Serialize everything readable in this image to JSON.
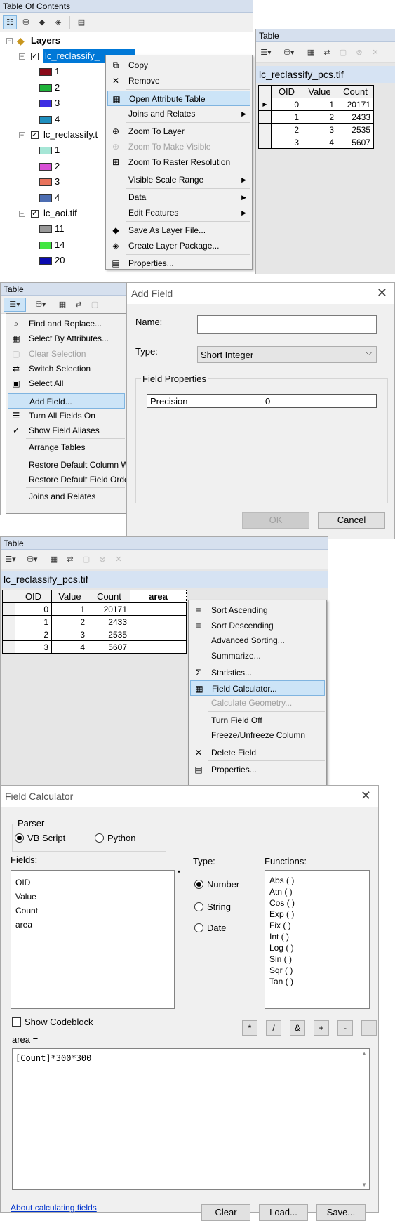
{
  "toc": {
    "title": "Table Of Contents",
    "root_label": "Layers",
    "layers": [
      {
        "name": "lc_reclassify_",
        "classes": [
          {
            "label": "1",
            "color": "#8b0a1a"
          },
          {
            "label": "2",
            "color": "#1fb33a"
          },
          {
            "label": "3",
            "color": "#3d2ee3"
          },
          {
            "label": "4",
            "color": "#1f8fbf"
          }
        ]
      },
      {
        "name": "lc_reclassify.t",
        "classes": [
          {
            "label": "1",
            "color": "#a6e6d6"
          },
          {
            "label": "2",
            "color": "#d84fd6"
          },
          {
            "label": "3",
            "color": "#e8735c"
          },
          {
            "label": "4",
            "color": "#4c6db2"
          }
        ]
      },
      {
        "name": "lc_aoi.tif",
        "classes": [
          {
            "label": "11",
            "color": "#999999"
          },
          {
            "label": "14",
            "color": "#42e642"
          },
          {
            "label": "20",
            "color": "#0b0bb0"
          }
        ]
      }
    ]
  },
  "layer_menu": {
    "items": [
      {
        "label": "Copy",
        "icon": "copy-icon",
        "glyph": "⧉"
      },
      {
        "label": "Remove",
        "icon": "remove-icon",
        "glyph": "✕"
      },
      {
        "label": "Open Attribute Table",
        "icon": "table-icon",
        "glyph": "▦",
        "highlight": true
      },
      {
        "label": "Joins and Relates",
        "submenu": true
      },
      {
        "label": "Zoom To Layer",
        "icon": "zoom-layer-icon",
        "glyph": "⊕"
      },
      {
        "label": "Zoom To Make Visible",
        "icon": "zoom-visible-icon",
        "glyph": "⊕",
        "disabled": true
      },
      {
        "label": "Zoom To Raster Resolution",
        "icon": "zoom-raster-icon",
        "glyph": "⊞"
      },
      {
        "label": "Visible Scale Range",
        "submenu": true
      },
      {
        "label": "Data",
        "submenu": true
      },
      {
        "label": "Edit Features",
        "submenu": true
      },
      {
        "label": "Save As Layer File...",
        "icon": "layer-file-icon",
        "glyph": "◆"
      },
      {
        "label": "Create Layer Package...",
        "icon": "package-icon",
        "glyph": "◈"
      },
      {
        "label": "Properties...",
        "icon": "properties-icon",
        "glyph": "▤"
      }
    ]
  },
  "table1": {
    "title": "Table",
    "tab_name": "lc_reclassify_pcs.tif",
    "columns": [
      "OID",
      "Value",
      "Count"
    ],
    "rows": [
      [
        "0",
        "1",
        "20171"
      ],
      [
        "1",
        "2",
        "2433"
      ],
      [
        "2",
        "3",
        "2535"
      ],
      [
        "3",
        "4",
        "5607"
      ]
    ]
  },
  "table2": {
    "title": "Table",
    "menu": {
      "items": [
        {
          "label": "Find and Replace...",
          "icon": "binoculars-icon",
          "glyph": "⌕"
        },
        {
          "label": "Select By Attributes...",
          "icon": "select-attributes-icon",
          "glyph": "▦"
        },
        {
          "label": "Clear Selection",
          "icon": "clear-selection-icon",
          "glyph": "▢",
          "disabled": true
        },
        {
          "label": "Switch Selection",
          "icon": "switch-selection-icon",
          "glyph": "⇄"
        },
        {
          "label": "Select All",
          "icon": "select-all-icon",
          "glyph": "▣"
        },
        {
          "label": "Add Field...",
          "highlight": true
        },
        {
          "label": "Turn All Fields On",
          "icon": "fields-on-icon",
          "glyph": "☰"
        },
        {
          "label": "Show Field Aliases",
          "icon": "check-icon",
          "glyph": "✓"
        },
        {
          "label": "Arrange Tables"
        },
        {
          "label": "Restore Default Column W"
        },
        {
          "label": "Restore Default Field Orde"
        },
        {
          "label": "Joins and Relates"
        }
      ]
    }
  },
  "add_field": {
    "title": "Add Field",
    "name_label": "Name:",
    "name_value": "",
    "type_label": "Type:",
    "type_value": "Short Integer",
    "props_label": "Field Properties",
    "prop_name": "Precision",
    "prop_value": "0",
    "ok": "OK",
    "cancel": "Cancel"
  },
  "table3": {
    "title": "Table",
    "tab_name": "lc_reclassify_pcs.tif",
    "columns": [
      "OID",
      "Value",
      "Count",
      "area"
    ],
    "rows": [
      [
        "0",
        "1",
        "20171",
        ""
      ],
      [
        "1",
        "2",
        "2433",
        ""
      ],
      [
        "2",
        "3",
        "2535",
        ""
      ],
      [
        "3",
        "4",
        "5607",
        ""
      ]
    ],
    "menu": {
      "items": [
        {
          "label": "Sort Ascending",
          "icon": "sort-ascending-icon",
          "glyph": "≡"
        },
        {
          "label": "Sort Descending",
          "icon": "sort-descending-icon",
          "glyph": "≡"
        },
        {
          "label": "Advanced Sorting..."
        },
        {
          "label": "Summarize..."
        },
        {
          "label": "Statistics...",
          "icon": "sigma-icon",
          "glyph": "Σ"
        },
        {
          "label": "Field Calculator...",
          "icon": "calculator-icon",
          "glyph": "▦",
          "highlight": true
        },
        {
          "label": "Calculate Geometry...",
          "disabled": true
        },
        {
          "label": "Turn Field Off"
        },
        {
          "label": "Freeze/Unfreeze Column"
        },
        {
          "label": "Delete Field",
          "icon": "delete-icon",
          "glyph": "✕"
        },
        {
          "label": "Properties...",
          "icon": "properties-icon",
          "glyph": "▤"
        }
      ]
    }
  },
  "field_calc": {
    "title": "Field Calculator",
    "parser_label": "Parser",
    "parser_vb": "VB Script",
    "parser_py": "Python",
    "fields_label": "Fields:",
    "fields": [
      "OID",
      "Value",
      "Count",
      "area"
    ],
    "type_label": "Type:",
    "type_number": "Number",
    "type_string": "String",
    "type_date": "Date",
    "functions_label": "Functions:",
    "functions": [
      "Abs ( )",
      "Atn ( )",
      "Cos ( )",
      "Exp ( )",
      "Fix ( )",
      "Int ( )",
      "Log ( )",
      "Sin ( )",
      "Sqr ( )",
      "Tan ( )"
    ],
    "show_codeblock": "Show Codeblock",
    "operators": [
      "*",
      "/",
      "&",
      "+",
      "-",
      "="
    ],
    "expr_label": "area =",
    "expression": "[Count]*300*300",
    "help_link": "About calculating fields",
    "clear": "Clear",
    "load": "Load...",
    "save": "Save..."
  }
}
